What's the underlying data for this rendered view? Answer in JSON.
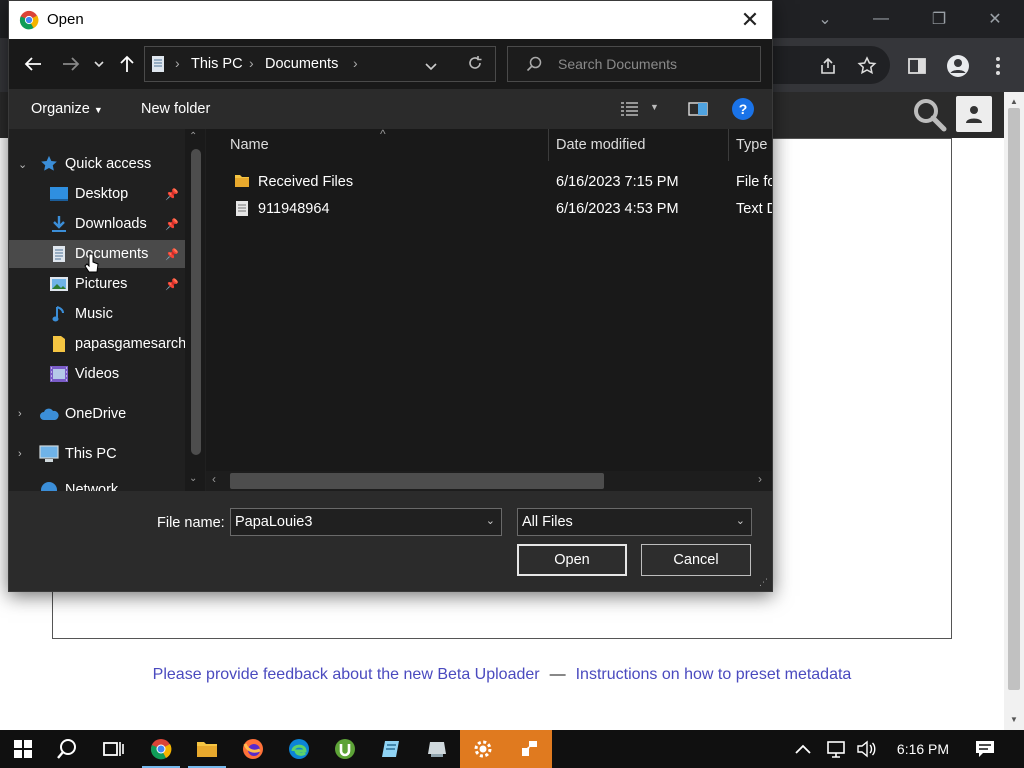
{
  "dialog": {
    "title": "Open",
    "address": {
      "root": "This PC",
      "folder": "Documents"
    },
    "search_placeholder": "Search Documents",
    "commands": {
      "organize": "Organize",
      "new_folder": "New folder",
      "help": "?"
    },
    "nav_pane": [
      {
        "label": "Quick access",
        "icon": "star-icon",
        "level": 0,
        "expandable": true,
        "expanded": true
      },
      {
        "label": "Desktop",
        "icon": "desktop-icon",
        "level": 1,
        "pinned": true
      },
      {
        "label": "Downloads",
        "icon": "download-icon",
        "level": 1,
        "pinned": true
      },
      {
        "label": "Documents",
        "icon": "document-icon",
        "level": 1,
        "pinned": true,
        "selected": true
      },
      {
        "label": "Pictures",
        "icon": "picture-icon",
        "level": 1,
        "pinned": true
      },
      {
        "label": "Music",
        "icon": "music-icon",
        "level": 1
      },
      {
        "label": "papasgamesarch",
        "icon": "folder-icon",
        "level": 1
      },
      {
        "label": "Videos",
        "icon": "video-icon",
        "level": 1
      },
      {
        "label": "OneDrive",
        "icon": "cloud-icon",
        "level": 0,
        "expandable": true
      },
      {
        "label": "This PC",
        "icon": "computer-icon",
        "level": 0,
        "expandable": true
      },
      {
        "label": "Network",
        "icon": "network-icon",
        "level": 0,
        "expandable": true
      }
    ],
    "columns": {
      "name": "Name",
      "date": "Date modified",
      "type": "Type"
    },
    "files": [
      {
        "name": "Received Files",
        "date": "6/16/2023 7:15 PM",
        "type": "File fo",
        "icon": "folder-icon"
      },
      {
        "name": "911948964",
        "date": "6/16/2023 4:53 PM",
        "type": "Text D",
        "icon": "text-file-icon"
      }
    ],
    "file_name_label": "File name:",
    "file_name_value": "PapaLouie3",
    "file_type_value": "All Files",
    "open_label": "Open",
    "cancel_label": "Cancel"
  },
  "page": {
    "feedback_link": "Please provide feedback about the new Beta Uploader",
    "separator": "—",
    "instructions_link": "Instructions on how to preset metadata"
  },
  "taskbar": {
    "clock": "6:16 PM"
  },
  "colors": {
    "dialog_bg": "#202020",
    "selection": "#4a4a4a",
    "link": "#4a4abf",
    "help_blue": "#1a73e8",
    "taskbar_accent": "#e07a1f"
  }
}
